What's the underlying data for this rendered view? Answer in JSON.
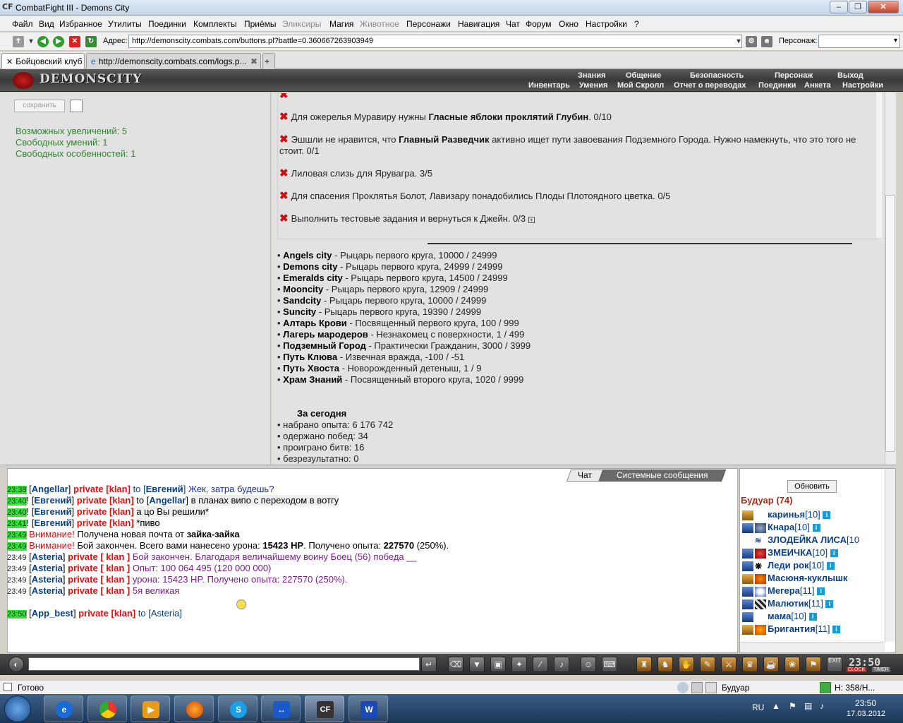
{
  "window": {
    "title": "CombatFight III - Demons City",
    "logo_text": "CF"
  },
  "menu": [
    "Файл",
    "Вид",
    "Избранное",
    "Утилиты",
    "Поединки",
    "Комплекты",
    "Приёмы",
    "Эликсиры",
    "Магия",
    "Животное",
    "Персонажи",
    "Навигация",
    "Чат",
    "Форум",
    "Окно",
    "Настройки",
    "?"
  ],
  "address": {
    "label": "Адрес:",
    "url": "http://demonscity.combats.com/buttons.pl?battle=0.360667263903949",
    "persona_label": "Персонаж:"
  },
  "tabs": [
    {
      "label": "Бойцовский клуб"
    },
    {
      "label": "http://demonscity.combats.com/logs.p..."
    }
  ],
  "game_header": {
    "logo": "DEMONSCITY",
    "nav_top": [
      "Знания",
      "Общение",
      "Безопасность",
      "Персонаж",
      "Выход"
    ],
    "nav_bottom": [
      "Инвентарь",
      "Умения",
      "Мой Скролл",
      "Отчет о переводах",
      "Поединки",
      "Анкета",
      "Настройки"
    ]
  },
  "left_panel": {
    "save_label": "сохранить",
    "stats": [
      "Возможных увеличений: 5",
      "Свободных умений: 1",
      "Свободных особенностей: 1"
    ]
  },
  "quests": [
    {
      "pre": "Для ожерелья Муравиру нужны ",
      "bold": "Гласные яблоки проклятий Глубин",
      "post": ". 0/10"
    },
    {
      "pre": "Эшшли не нравится, что ",
      "bold": "Главный Разведчик",
      "post": " активно ищет пути завоевания Подземного Города. Нужно намекнуть, что это того не стоит. 0/1"
    },
    {
      "pre": "Лиловая слизь для Ярувагра. 3/5",
      "bold": "",
      "post": ""
    },
    {
      "pre": "Для спасения Проклятья Болот, Лавизару понадобились Плоды Плотоядного цветка. 0/5",
      "bold": "",
      "post": ""
    },
    {
      "pre": "Выполнить тестовые задания и вернуться к Джейн. 0/3",
      "bold": "",
      "post": ""
    }
  ],
  "reputation": [
    {
      "city": "Angels city",
      "text": " - Рыцарь первого круга, 10000 / 24999"
    },
    {
      "city": "Demons city",
      "text": " - Рыцарь первого круга, 24999 / 24999"
    },
    {
      "city": "Emeralds city",
      "text": " - Рыцарь первого круга, 14500 / 24999"
    },
    {
      "city": "Mooncity",
      "text": " - Рыцарь первого круга, 12909 / 24999"
    },
    {
      "city": "Sandcity",
      "text": " - Рыцарь первого круга, 10000 / 24999"
    },
    {
      "city": "Suncity",
      "text": " - Рыцарь первого круга, 19390 / 24999"
    },
    {
      "city": "Алтарь Крови",
      "text": " - Посвященный первого круга, 100 / 999"
    },
    {
      "city": "Лагерь мародеров",
      "text": " - Незнакомец с поверхности, 1 / 499"
    },
    {
      "city": "Подземный Город",
      "text": " - Практически Гражданин, 3000 / 3999"
    },
    {
      "city": "Путь Клюва",
      "text": " - Извечная вражда, -100 / -51"
    },
    {
      "city": "Путь Хвоста",
      "text": " - Новорожденный детеныш, 1 / 9"
    },
    {
      "city": "Храм Знаний",
      "text": " - Посвященный второго круга, 1020 / 9999"
    }
  ],
  "today": {
    "title": "За сегодня",
    "items": [
      "набрано опыта: 6 176 742",
      "одержано побед: 34",
      "проиграно битв: 16",
      "безрезультатно: 0"
    ]
  },
  "chat": {
    "tab_chat": "Чат",
    "tab_system": "Системные сообщения",
    "lines": [
      {
        "time": "23:38",
        "from": "Angellar",
        "priv": "private [klan]",
        "to": "Евгений",
        "msg": "Жек, затра будешь?"
      },
      {
        "time": "23:40",
        "from": "Евгений",
        "priv": "private [klan]",
        "to": "Angellar",
        "msg": "в планах випо с переходом в вотгу"
      },
      {
        "time": "23:40",
        "from": "Евгений",
        "priv": "private [klan]",
        "msg": "а цо Вы решили*"
      },
      {
        "time": "23:41",
        "from": "Евгений",
        "priv": "private [klan]",
        "msg": "*пиво"
      },
      {
        "time": "23:49",
        "warn": "Внимание!",
        "msg": "Получена новая почта от ",
        "bold": "зайка-зайка"
      },
      {
        "time": "23:49",
        "warn": "Внимание!",
        "msg": "Бой закончен. Всего вами нанесено урона: ",
        "bold1": "15423 HP",
        "msg2": ". Получено опыта: ",
        "bold2": "227570",
        "msg3": " (250%)."
      },
      {
        "time": "23:49",
        "from": "Asteria",
        "priv": "private [ klan ]",
        "msg": "Бой закончен. Благодаря величайшему воину Боец (56) победа __"
      },
      {
        "time": "23:49",
        "from": "Asteria",
        "priv": "private [ klan ]",
        "msg": "Опыт: 100 064 495 (120 000 000)"
      },
      {
        "time": "23:49",
        "from": "Asteria",
        "priv": "private [ klan ]",
        "msg": "урона: 15423 HP. Получено опыта: 227570 (250%)."
      },
      {
        "time": "23:49",
        "from": "Asteria",
        "priv": "private [ klan ]",
        "msg": "5я великая"
      },
      {
        "time": "23:50",
        "from": "App_best",
        "priv": "private [klan]",
        "to": "Asteria",
        "msg": ""
      }
    ]
  },
  "userlist": {
    "refresh_label": "Обновить",
    "room": "Будуар (74)",
    "users": [
      {
        "name": "каринья",
        "level": "[10]"
      },
      {
        "name": "Кнара",
        "level": "[10]"
      },
      {
        "name": "ЗЛОДЕЙКА ЛИСА",
        "level": "[10"
      },
      {
        "name": "ЗМЕИЧКА",
        "level": "[10]"
      },
      {
        "name": "Леди рок",
        "level": "[10]"
      },
      {
        "name": "Масюня-куклышк",
        "level": ""
      },
      {
        "name": "Мегера",
        "level": "[11]"
      },
      {
        "name": "Малютик",
        "level": "[11]"
      },
      {
        "name": "мама",
        "level": "[10]"
      },
      {
        "name": "Бригантия",
        "level": "[11]"
      }
    ]
  },
  "clock": {
    "time": "23:50",
    "clock_label": "CLOCK",
    "timer_label": "TIMER",
    "exit_label": "EXIT"
  },
  "statusbar": {
    "status": "Готово",
    "room": "Будуар",
    "hp": "Н: 358/Н..."
  },
  "taskbar": {
    "lang": "RU",
    "time": "23:50",
    "date": "17.03.2012"
  }
}
